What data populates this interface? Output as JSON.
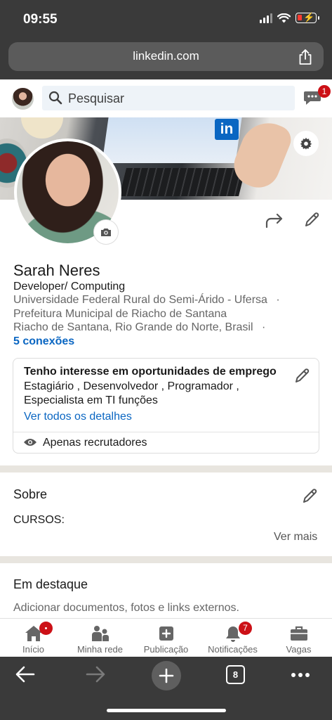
{
  "status_bar": {
    "time": "09:55"
  },
  "browser": {
    "url": "linkedin.com",
    "tab_count": "8"
  },
  "header": {
    "search_placeholder": "Pesquisar",
    "messages_badge": "1"
  },
  "profile": {
    "name": "Sarah Neres",
    "headline": "Developer/ Computing",
    "education": "Universidade Federal Rural do Semi-Árido - Ufersa",
    "company": "Prefeitura Municipal de Riacho de Santana",
    "location": "Riacho de Santana, Rio Grande do Norte, Brasil",
    "separator": "·",
    "connections": "5 conexões"
  },
  "open_to_work": {
    "title": "Tenho interesse em oportunidades de emprego",
    "roles": "Estagiário , Desenvolvedor , Programador , Especialista em TI funções",
    "details_link": "Ver todos os detalhes",
    "visibility": "Apenas recrutadores"
  },
  "about": {
    "title": "Sobre",
    "text": "CURSOS:",
    "more": "Ver mais"
  },
  "featured": {
    "title": "Em destaque",
    "text": "Adicionar documentos, fotos e links externos."
  },
  "cover": {
    "logo_text": "in"
  },
  "nav": {
    "items": [
      {
        "label": "Início",
        "icon": "home-icon"
      },
      {
        "label": "Minha rede",
        "icon": "network-icon"
      },
      {
        "label": "Publicação",
        "icon": "post-icon"
      },
      {
        "label": "Notificações",
        "icon": "bell-icon",
        "badge": "7"
      },
      {
        "label": "Vagas",
        "icon": "briefcase-icon"
      }
    ]
  },
  "colors": {
    "brand": "#0a66c2",
    "badge": "#cc1016",
    "chrome": "#3a3a3a"
  }
}
